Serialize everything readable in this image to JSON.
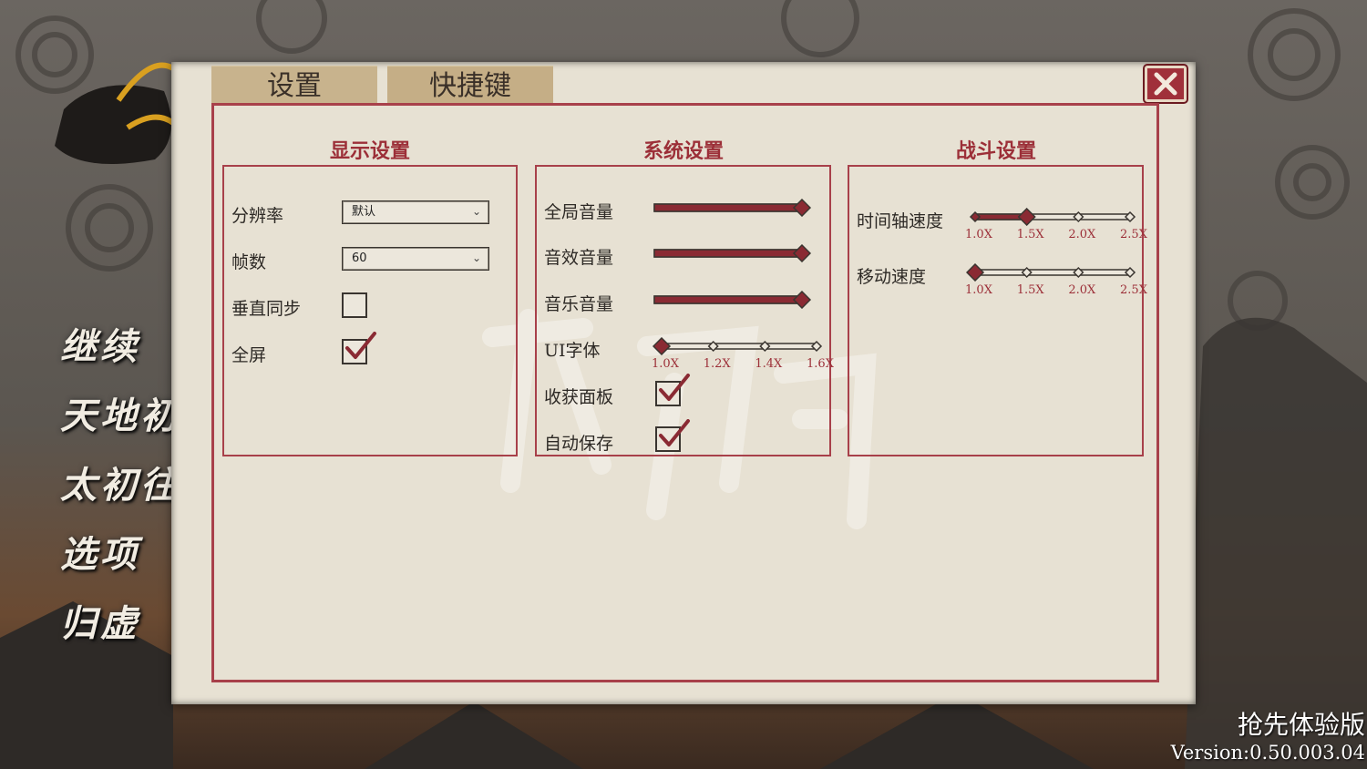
{
  "colors": {
    "accent": "#9c2f38",
    "panel": "#e7e1d3",
    "tab": "#c8b38d",
    "slider_fill": "#8a2a33"
  },
  "tabs": [
    {
      "label": "设置"
    },
    {
      "label": "快捷键"
    }
  ],
  "close_icon": "close-icon",
  "main_menu": [
    {
      "label": "继续"
    },
    {
      "label": "天地初"
    },
    {
      "label": "太初往"
    },
    {
      "label": "选项"
    },
    {
      "label": "归虚"
    }
  ],
  "display": {
    "title": "显示设置",
    "resolution": {
      "label": "分辨率",
      "value": "默认"
    },
    "framerate": {
      "label": "帧数",
      "value": "60"
    },
    "vsync": {
      "label": "垂直同步",
      "checked": false
    },
    "fullscreen": {
      "label": "全屏",
      "checked": true
    }
  },
  "system": {
    "title": "系统设置",
    "master_volume": {
      "label": "全局音量",
      "value": 1.0
    },
    "sfx_volume": {
      "label": "音效音量",
      "value": 1.0
    },
    "music_volume": {
      "label": "音乐音量",
      "value": 1.0
    },
    "ui_font": {
      "label": "UI字体",
      "options": [
        "1.0X",
        "1.2X",
        "1.4X",
        "1.6X"
      ],
      "selected_index": 0
    },
    "harvest_panel": {
      "label": "收获面板",
      "checked": true
    },
    "autosave": {
      "label": "自动保存",
      "checked": true
    }
  },
  "combat": {
    "title": "战斗设置",
    "timeline_speed": {
      "label": "时间轴速度",
      "options": [
        "1.0X",
        "1.5X",
        "2.0X",
        "2.5X"
      ],
      "selected_index": 1
    },
    "move_speed": {
      "label": "移动速度",
      "options": [
        "1.0X",
        "1.5X",
        "2.0X",
        "2.5X"
      ],
      "selected_index": 0
    }
  },
  "footer": {
    "edition": "抢先体验版",
    "version": "Version:0.50.003.04"
  }
}
